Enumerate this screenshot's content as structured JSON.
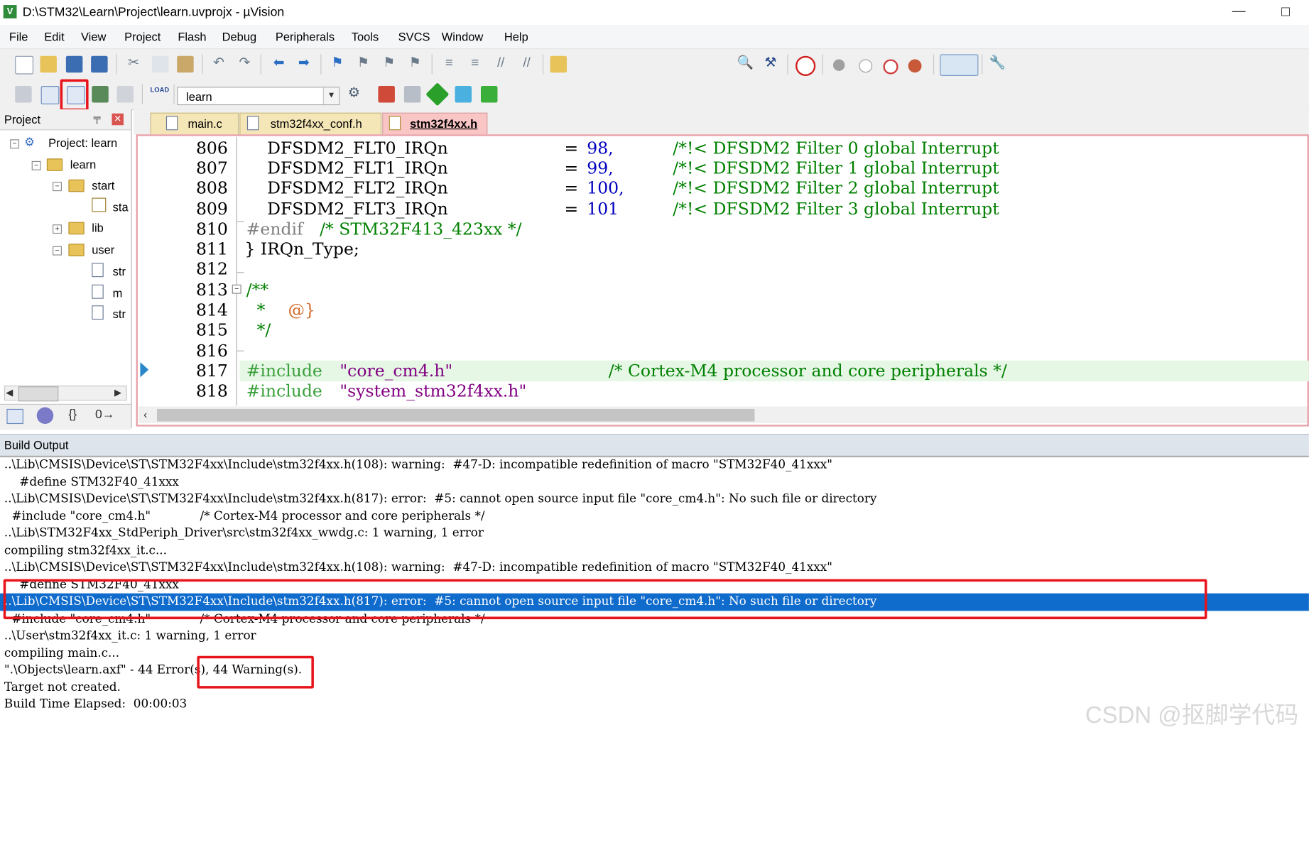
{
  "window": {
    "title": "D:\\STM32\\Learn\\Project\\learn.uvprojx - µVision",
    "min_glyph": "—",
    "max_glyph": "☐"
  },
  "menu": [
    "File",
    "Edit",
    "View",
    "Project",
    "Flash",
    "Debug",
    "Peripherals",
    "Tools",
    "SVCS",
    "Window",
    "Help"
  ],
  "toolbar2": {
    "target_name": "learn",
    "load_label": "LOAD"
  },
  "project_panel": {
    "title": "Project",
    "pin_glyph": "╤",
    "tree": {
      "root": "Project: learn",
      "target": "learn",
      "group_start": "start",
      "start_file": "sta",
      "group_lib": "lib",
      "group_user": "user",
      "user_file_1": "str",
      "user_file_2": "m",
      "user_file_3": "str"
    }
  },
  "editor": {
    "tabs": [
      {
        "label": "main.c"
      },
      {
        "label": "stm32f4xx_conf.h"
      },
      {
        "label": "stm32f4xx.h"
      }
    ],
    "line_numbers": [
      "806",
      "807",
      "808",
      "809",
      "810",
      "811",
      "812",
      "813",
      "814",
      "815",
      "816",
      "817",
      "818"
    ],
    "lines": {
      "l806a": "DFSDM2_FLT0_IRQn",
      "l806b": "=",
      "l806c": "98,",
      "l806d": "/*!< DFSDM2 Filter 0 global Interrupt",
      "l807a": "DFSDM2_FLT1_IRQn",
      "l807b": "=",
      "l807c": "99,",
      "l807d": "/*!< DFSDM2 Filter 1 global Interrupt",
      "l808a": "DFSDM2_FLT2_IRQn",
      "l808b": "=",
      "l808c": "100,",
      "l808d": "/*!< DFSDM2 Filter 2 global Interrupt",
      "l809a": "DFSDM2_FLT3_IRQn",
      "l809b": "=",
      "l809c": "101",
      "l809d": "/*!< DFSDM2 Filter 3 global Interrupt",
      "l810a": "#endif",
      "l810b": "/* STM32F413_423xx */",
      "l811": "} IRQn_Type;",
      "l813": "/**",
      "l814a": "  *",
      "l814b": "@}",
      "l815": "  */",
      "l817a": "#include",
      "l817b": "\"core_cm4.h\"",
      "l817c": "/* Cortex-M4 processor and core peripherals */",
      "l818a": "#include",
      "l818b": "\"system_stm32f4xx.h\""
    }
  },
  "build_output": {
    "title": "Build Output",
    "lines": [
      "..\\Lib\\CMSIS\\Device\\ST\\STM32F4xx\\Include\\stm32f4xx.h(108): warning:  #47-D: incompatible redefinition of macro \"STM32F40_41xxx\"",
      "    #define STM32F40_41xxx",
      "..\\Lib\\CMSIS\\Device\\ST\\STM32F4xx\\Include\\stm32f4xx.h(817): error:  #5: cannot open source input file \"core_cm4.h\": No such file or directory",
      "  #include \"core_cm4.h\"             /* Cortex-M4 processor and core peripherals */",
      "..\\Lib\\STM32F4xx_StdPeriph_Driver\\src\\stm32f4xx_wwdg.c: 1 warning, 1 error",
      "compiling stm32f4xx_it.c...",
      "..\\Lib\\CMSIS\\Device\\ST\\STM32F4xx\\Include\\stm32f4xx.h(108): warning:  #47-D: incompatible redefinition of macro \"STM32F40_41xxx\"",
      "    #define STM32F40_41xxx",
      "..\\Lib\\CMSIS\\Device\\ST\\STM32F4xx\\Include\\stm32f4xx.h(817): error:  #5: cannot open source input file \"core_cm4.h\": No such file or directory",
      "  #include \"core_cm4.h\"             /* Cortex-M4 processor and core peripherals */",
      "..\\User\\stm32f4xx_it.c: 1 warning, 1 error",
      "compiling main.c...",
      "\".\\Objects\\learn.axf\" - 44 Error(s), 44 Warning(s).",
      "Target not created.",
      "Build Time Elapsed:  00:00:03"
    ]
  },
  "watermark": "CSDN @抠脚学代码",
  "colors": {
    "highlight_red": "#e8141b",
    "selection_blue": "#0f6bcc",
    "comment_green": "#008000",
    "number_blue": "#0000c0"
  }
}
